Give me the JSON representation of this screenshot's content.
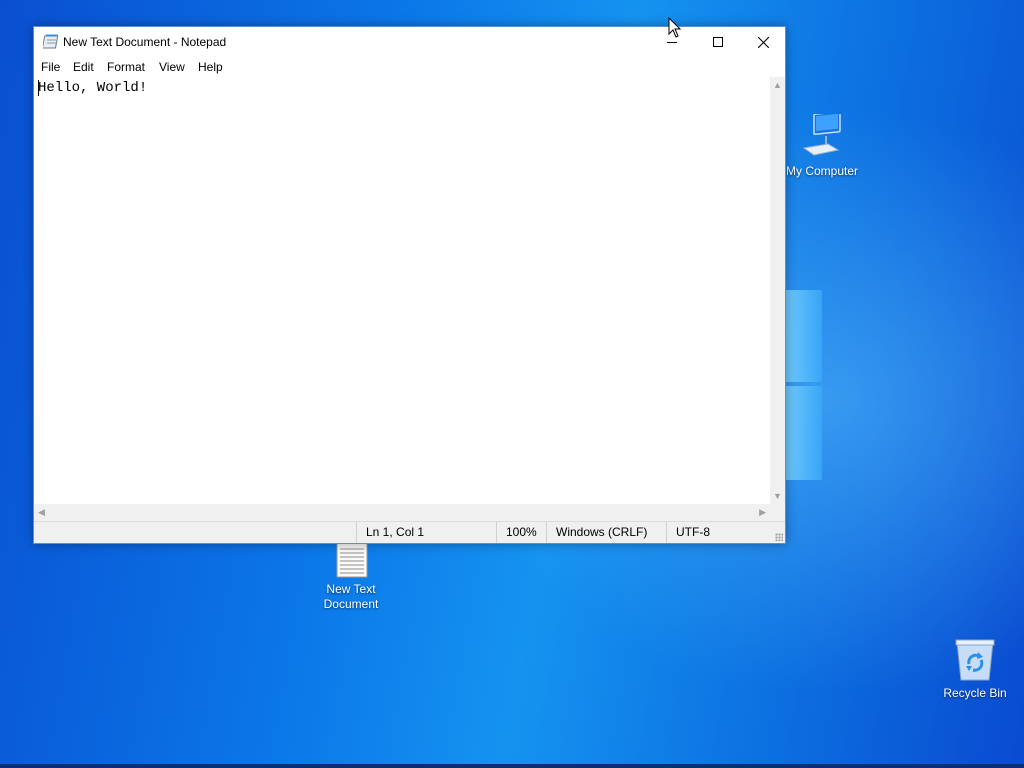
{
  "window": {
    "title": "New Text Document - Notepad",
    "menu": [
      "File",
      "Edit",
      "Format",
      "View",
      "Help"
    ],
    "content": "Hello, World!"
  },
  "status": {
    "position": "Ln 1, Col 1",
    "zoom": "100%",
    "line_ending": "Windows (CRLF)",
    "encoding": "UTF-8"
  },
  "desktop": {
    "icons": {
      "my_computer": "My Computer",
      "text_doc_line1": "New Text",
      "text_doc_line2": "Document",
      "recycle_bin": "Recycle Bin"
    }
  },
  "colors": {
    "desktop_blue": "#0b77e8",
    "window_border": "#5a8fd0",
    "statusbar_bg": "#f0f0f0"
  }
}
